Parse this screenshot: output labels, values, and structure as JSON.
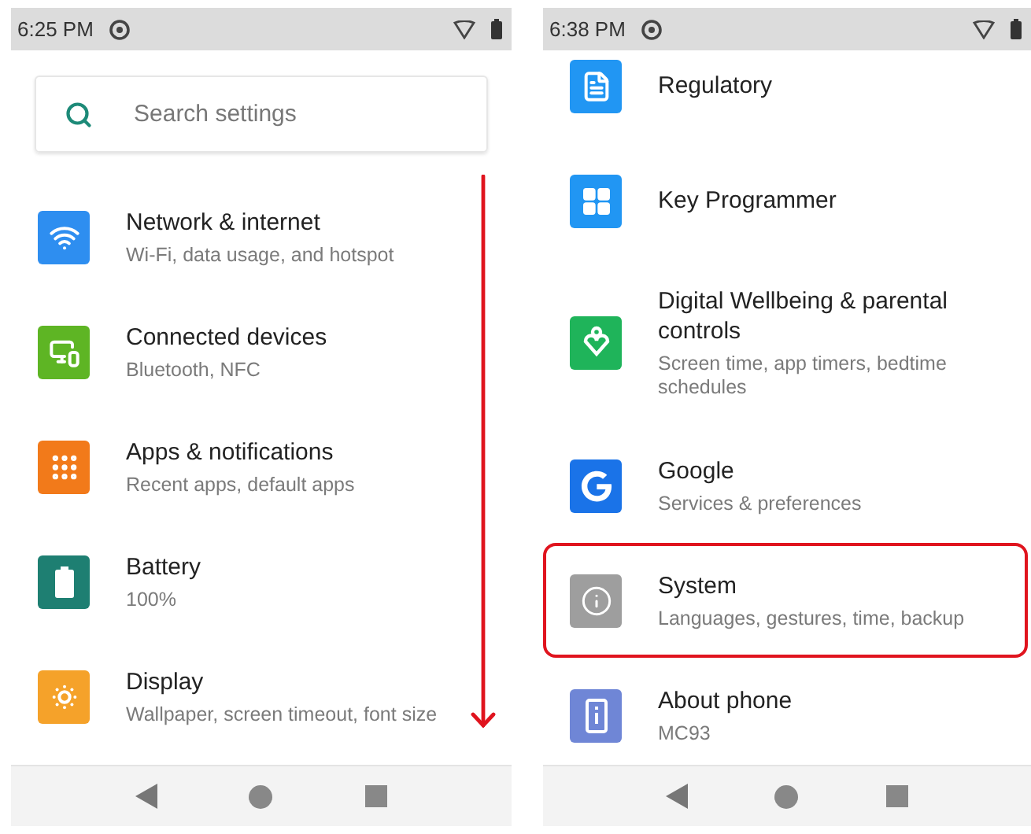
{
  "screens": [
    {
      "status_bar": {
        "time": "6:25 PM"
      },
      "search": {
        "placeholder": "Search settings"
      },
      "items": [
        {
          "kind": "wifi",
          "color": "#2e8ef0",
          "title": "Network & internet",
          "subtitle": "Wi-Fi, data usage, and hotspot",
          "highlighted": false
        },
        {
          "kind": "devices",
          "color": "#5eb524",
          "title": "Connected devices",
          "subtitle": "Bluetooth, NFC",
          "highlighted": false
        },
        {
          "kind": "apps",
          "color": "#f27a1a",
          "title": "Apps & notifications",
          "subtitle": "Recent apps, default apps",
          "highlighted": false
        },
        {
          "kind": "battery",
          "color": "#1e7f72",
          "title": "Battery",
          "subtitle": "100%",
          "highlighted": false
        },
        {
          "kind": "display",
          "color": "#f5a22a",
          "title": "Display",
          "subtitle": "Wallpaper, screen timeout, font size",
          "highlighted": false
        }
      ],
      "scroll_arrow": true
    },
    {
      "status_bar": {
        "time": "6:38 PM"
      },
      "items": [
        {
          "kind": "document",
          "color": "#2196f3",
          "title": "Regulatory",
          "highlighted": false
        },
        {
          "kind": "grid",
          "color": "#2196f3",
          "title": "Key Programmer",
          "highlighted": false
        },
        {
          "kind": "wellbeing",
          "color": "#1fb45a",
          "title": "Digital Wellbeing & parental controls",
          "subtitle": "Screen time, app timers, bedtime schedules",
          "highlighted": false
        },
        {
          "kind": "google",
          "color": "#1a73e8",
          "title": "Google",
          "subtitle": "Services & preferences",
          "highlighted": false
        },
        {
          "kind": "info",
          "color": "#9e9e9e",
          "title": "System",
          "subtitle": "Languages, gestures, time, backup",
          "highlighted": true
        },
        {
          "kind": "phone",
          "color": "#6f86d6",
          "title": "About phone",
          "subtitle": "MC93",
          "highlighted": false
        }
      ],
      "scroll_arrow": false
    }
  ]
}
